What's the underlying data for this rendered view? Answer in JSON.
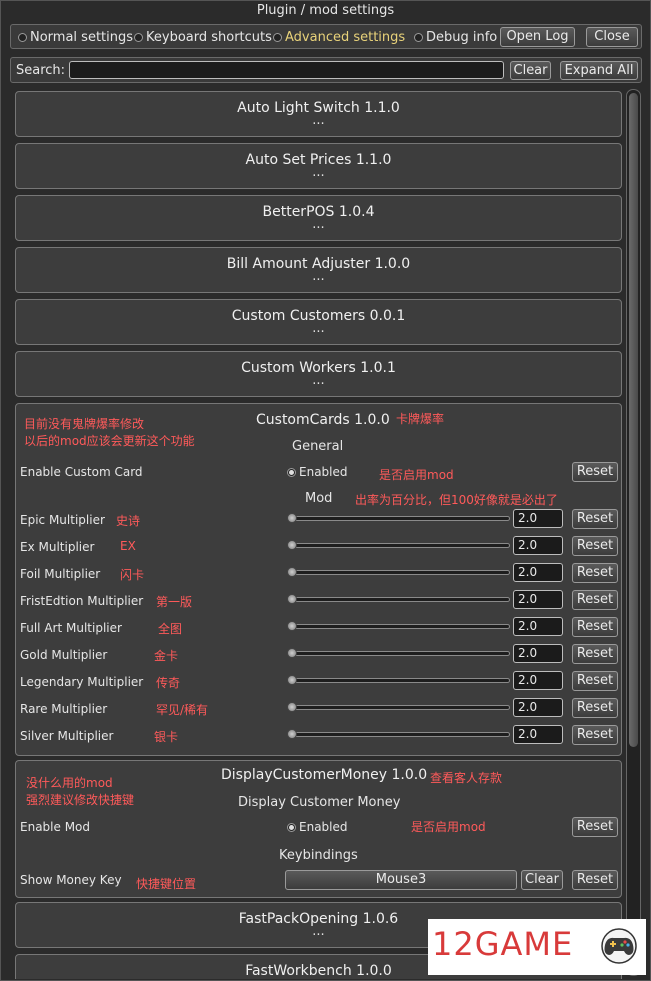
{
  "window": {
    "title": "Plugin / mod settings"
  },
  "toolbar": {
    "tabs": [
      {
        "label": "Normal settings",
        "selected": false
      },
      {
        "label": "Keyboard shortcuts",
        "selected": false
      },
      {
        "label": "Advanced settings",
        "selected": false,
        "color": "#e8d27a"
      },
      {
        "label": "Debug info",
        "selected": false
      }
    ],
    "open_log_label": "Open Log",
    "close_label": "Close"
  },
  "search": {
    "label": "Search:",
    "value": "",
    "clear_label": "Clear",
    "expand_all_label": "Expand All"
  },
  "plugins_collapsed_top": [
    {
      "name": "Auto Light Switch 1.1.0",
      "ellipsis": "..."
    },
    {
      "name": "Auto Set Prices 1.1.0",
      "ellipsis": "..."
    },
    {
      "name": "BetterPOS 1.0.4",
      "ellipsis": "..."
    },
    {
      "name": "Bill Amount Adjuster 1.0.0",
      "ellipsis": "..."
    },
    {
      "name": "Custom Customers 0.0.1",
      "ellipsis": "..."
    },
    {
      "name": "Custom Workers 1.0.1",
      "ellipsis": "..."
    }
  ],
  "custom_cards": {
    "name": "CustomCards 1.0.0",
    "note_title": "卡牌爆率",
    "note_top_1": "目前没有鬼牌爆率修改",
    "note_top_2": "以后的mod应该会更新这个功能",
    "section_general": "General",
    "enable_label": "Enable Custom Card",
    "enable_value": "Enabled",
    "enable_note": "是否启用mod",
    "section_mod": "Mod",
    "mod_note": "出率为百分比，但100好像就是必出了",
    "reset_label": "Reset",
    "multipliers": [
      {
        "label": "Epic Multiplier",
        "value": "2.0",
        "note": "史诗"
      },
      {
        "label": "Ex Multiplier",
        "value": "2.0",
        "note": "EX"
      },
      {
        "label": "Foil Multiplier",
        "value": "2.0",
        "note": "闪卡"
      },
      {
        "label": "FristEdtion Multiplier",
        "value": "2.0",
        "note": "第一版"
      },
      {
        "label": "Full Art  Multiplier",
        "value": "2.0",
        "note": "全图"
      },
      {
        "label": "Gold Multiplier",
        "value": "2.0",
        "note": "金卡"
      },
      {
        "label": "Legendary Multiplier",
        "value": "2.0",
        "note": "传奇"
      },
      {
        "label": "Rare Multiplier",
        "value": "2.0",
        "note": "罕见/稀有"
      },
      {
        "label": "Silver Multiplier",
        "value": "2.0",
        "note": "银卡"
      }
    ]
  },
  "display_customer_money": {
    "name": "DisplayCustomerMoney 1.0.0",
    "note_title": "查看客人存款",
    "note_top_1": "没什么用的mod",
    "note_top_2": "强烈建议修改快捷键",
    "section_main": "Display Customer Money",
    "enable_label": "Enable Mod",
    "enable_value": "Enabled",
    "enable_note": "是否启用mod",
    "section_keys": "Keybindings",
    "key_label": "Show Money Key",
    "key_note": "快捷键位置",
    "key_value": "Mouse3",
    "clear_label": "Clear",
    "reset_label": "Reset"
  },
  "plugins_collapsed_bottom": [
    {
      "name": "FastPackOpening 1.0.6",
      "ellipsis": "..."
    },
    {
      "name": "FastWorkbench 1.0.0",
      "ellipsis": "..."
    }
  ],
  "watermark": {
    "text": "12GAME",
    "icon": "game-controller-icon"
  }
}
